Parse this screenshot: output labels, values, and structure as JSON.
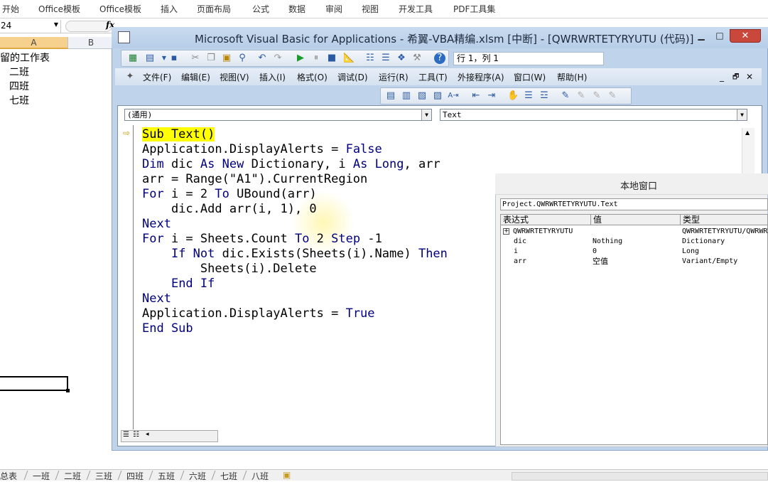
{
  "excel": {
    "ribbon_tabs": [
      "开始",
      "Office模板",
      "Office模板",
      "插入",
      "页面布局",
      "公式",
      "数据",
      "审阅",
      "视图",
      "开发工具",
      "PDF工具集"
    ],
    "name_box": "24",
    "fx_label": "fx",
    "col_a": "A",
    "col_b": "B",
    "cells": [
      "保留的工作表",
      "二班",
      "四班",
      "七班"
    ],
    "sheet_tabs": [
      "总表",
      "一班",
      "二班",
      "三班",
      "四班",
      "五班",
      "六班",
      "七班",
      "八班"
    ]
  },
  "vbe": {
    "title": "Microsoft Visual Basic for Applications - 希翼-VBA精编.xlsm [中断] - [QWRWRTETYRYUTU (代码)]",
    "position": "行 1，列 1",
    "menus": [
      "文件(F)",
      "编辑(E)",
      "视图(V)",
      "插入(I)",
      "格式(O)",
      "调试(D)",
      "运行(R)",
      "工具(T)",
      "外接程序(A)",
      "窗口(W)",
      "帮助(H)"
    ],
    "object_combo": "(通用)",
    "proc_combo": "Text",
    "close_glyph": "✕",
    "min_glyph": "▁",
    "max_glyph": "□",
    "inner_min": "_",
    "inner_restore": "🗗",
    "inner_close": "✕"
  },
  "code": {
    "lines": [
      {
        "indent": "",
        "parts": [
          {
            "t": "Sub Text()",
            "c": "hl"
          }
        ]
      },
      {
        "indent": "",
        "parts": [
          {
            "t": "Application.DisplayAlerts = ",
            "c": ""
          },
          {
            "t": "False",
            "c": "kw"
          }
        ]
      },
      {
        "indent": "",
        "parts": [
          {
            "t": "Dim",
            "c": "kw"
          },
          {
            "t": " dic ",
            "c": ""
          },
          {
            "t": "As New",
            "c": "kw"
          },
          {
            "t": " Dictionary, i ",
            "c": ""
          },
          {
            "t": "As Long",
            "c": "kw"
          },
          {
            "t": ", arr",
            "c": ""
          }
        ]
      },
      {
        "indent": "",
        "parts": [
          {
            "t": "arr = Range(\"A1\").CurrentRegion",
            "c": ""
          }
        ]
      },
      {
        "indent": "",
        "parts": [
          {
            "t": "For",
            "c": "kw"
          },
          {
            "t": " i = 2 ",
            "c": ""
          },
          {
            "t": "To",
            "c": "kw"
          },
          {
            "t": " UBound(arr)",
            "c": ""
          }
        ]
      },
      {
        "indent": "    ",
        "parts": [
          {
            "t": "dic.Add arr(i, 1), 0",
            "c": ""
          }
        ]
      },
      {
        "indent": "",
        "parts": [
          {
            "t": "Next",
            "c": "kw"
          }
        ]
      },
      {
        "indent": "",
        "parts": [
          {
            "t": "For",
            "c": "kw"
          },
          {
            "t": " i = Sheets.Count ",
            "c": ""
          },
          {
            "t": "To",
            "c": "kw"
          },
          {
            "t": " 2 ",
            "c": ""
          },
          {
            "t": "Step",
            "c": "kw"
          },
          {
            "t": " -1",
            "c": ""
          }
        ]
      },
      {
        "indent": "    ",
        "parts": [
          {
            "t": "If Not",
            "c": "kw"
          },
          {
            "t": " dic.Exists(Sheets(i).Name) ",
            "c": ""
          },
          {
            "t": "Then",
            "c": "kw"
          }
        ]
      },
      {
        "indent": "        ",
        "parts": [
          {
            "t": "Sheets(i).Delete",
            "c": ""
          }
        ]
      },
      {
        "indent": "    ",
        "parts": [
          {
            "t": "End If",
            "c": "kw"
          }
        ]
      },
      {
        "indent": "",
        "parts": [
          {
            "t": "Next",
            "c": "kw"
          }
        ]
      },
      {
        "indent": "",
        "parts": [
          {
            "t": "Application.DisplayAlerts = ",
            "c": ""
          },
          {
            "t": "True",
            "c": "kw"
          }
        ]
      },
      {
        "indent": "",
        "parts": [
          {
            "t": "End Sub",
            "c": "kw"
          }
        ]
      }
    ]
  },
  "locals": {
    "title": "本地窗口",
    "context": "Project.QWRWRTETYRYUTU.Text",
    "headers": [
      "表达式",
      "值",
      "类型"
    ],
    "rows": [
      {
        "expr": "QWRWRTETYRYUTU",
        "value": "",
        "type": "QWRWRTETYRYUTU/QWRWRT"
      },
      {
        "expr": "dic",
        "value": "Nothing",
        "type": "Dictionary"
      },
      {
        "expr": "i",
        "value": "0",
        "type": "Long"
      },
      {
        "expr": "arr",
        "value": "空值",
        "type": "Variant/Empty"
      }
    ]
  },
  "colors": {
    "highlight": "#ffff00",
    "keyword": "#00007f",
    "title_bar": "#c9dbef",
    "close": "#c9473b"
  }
}
